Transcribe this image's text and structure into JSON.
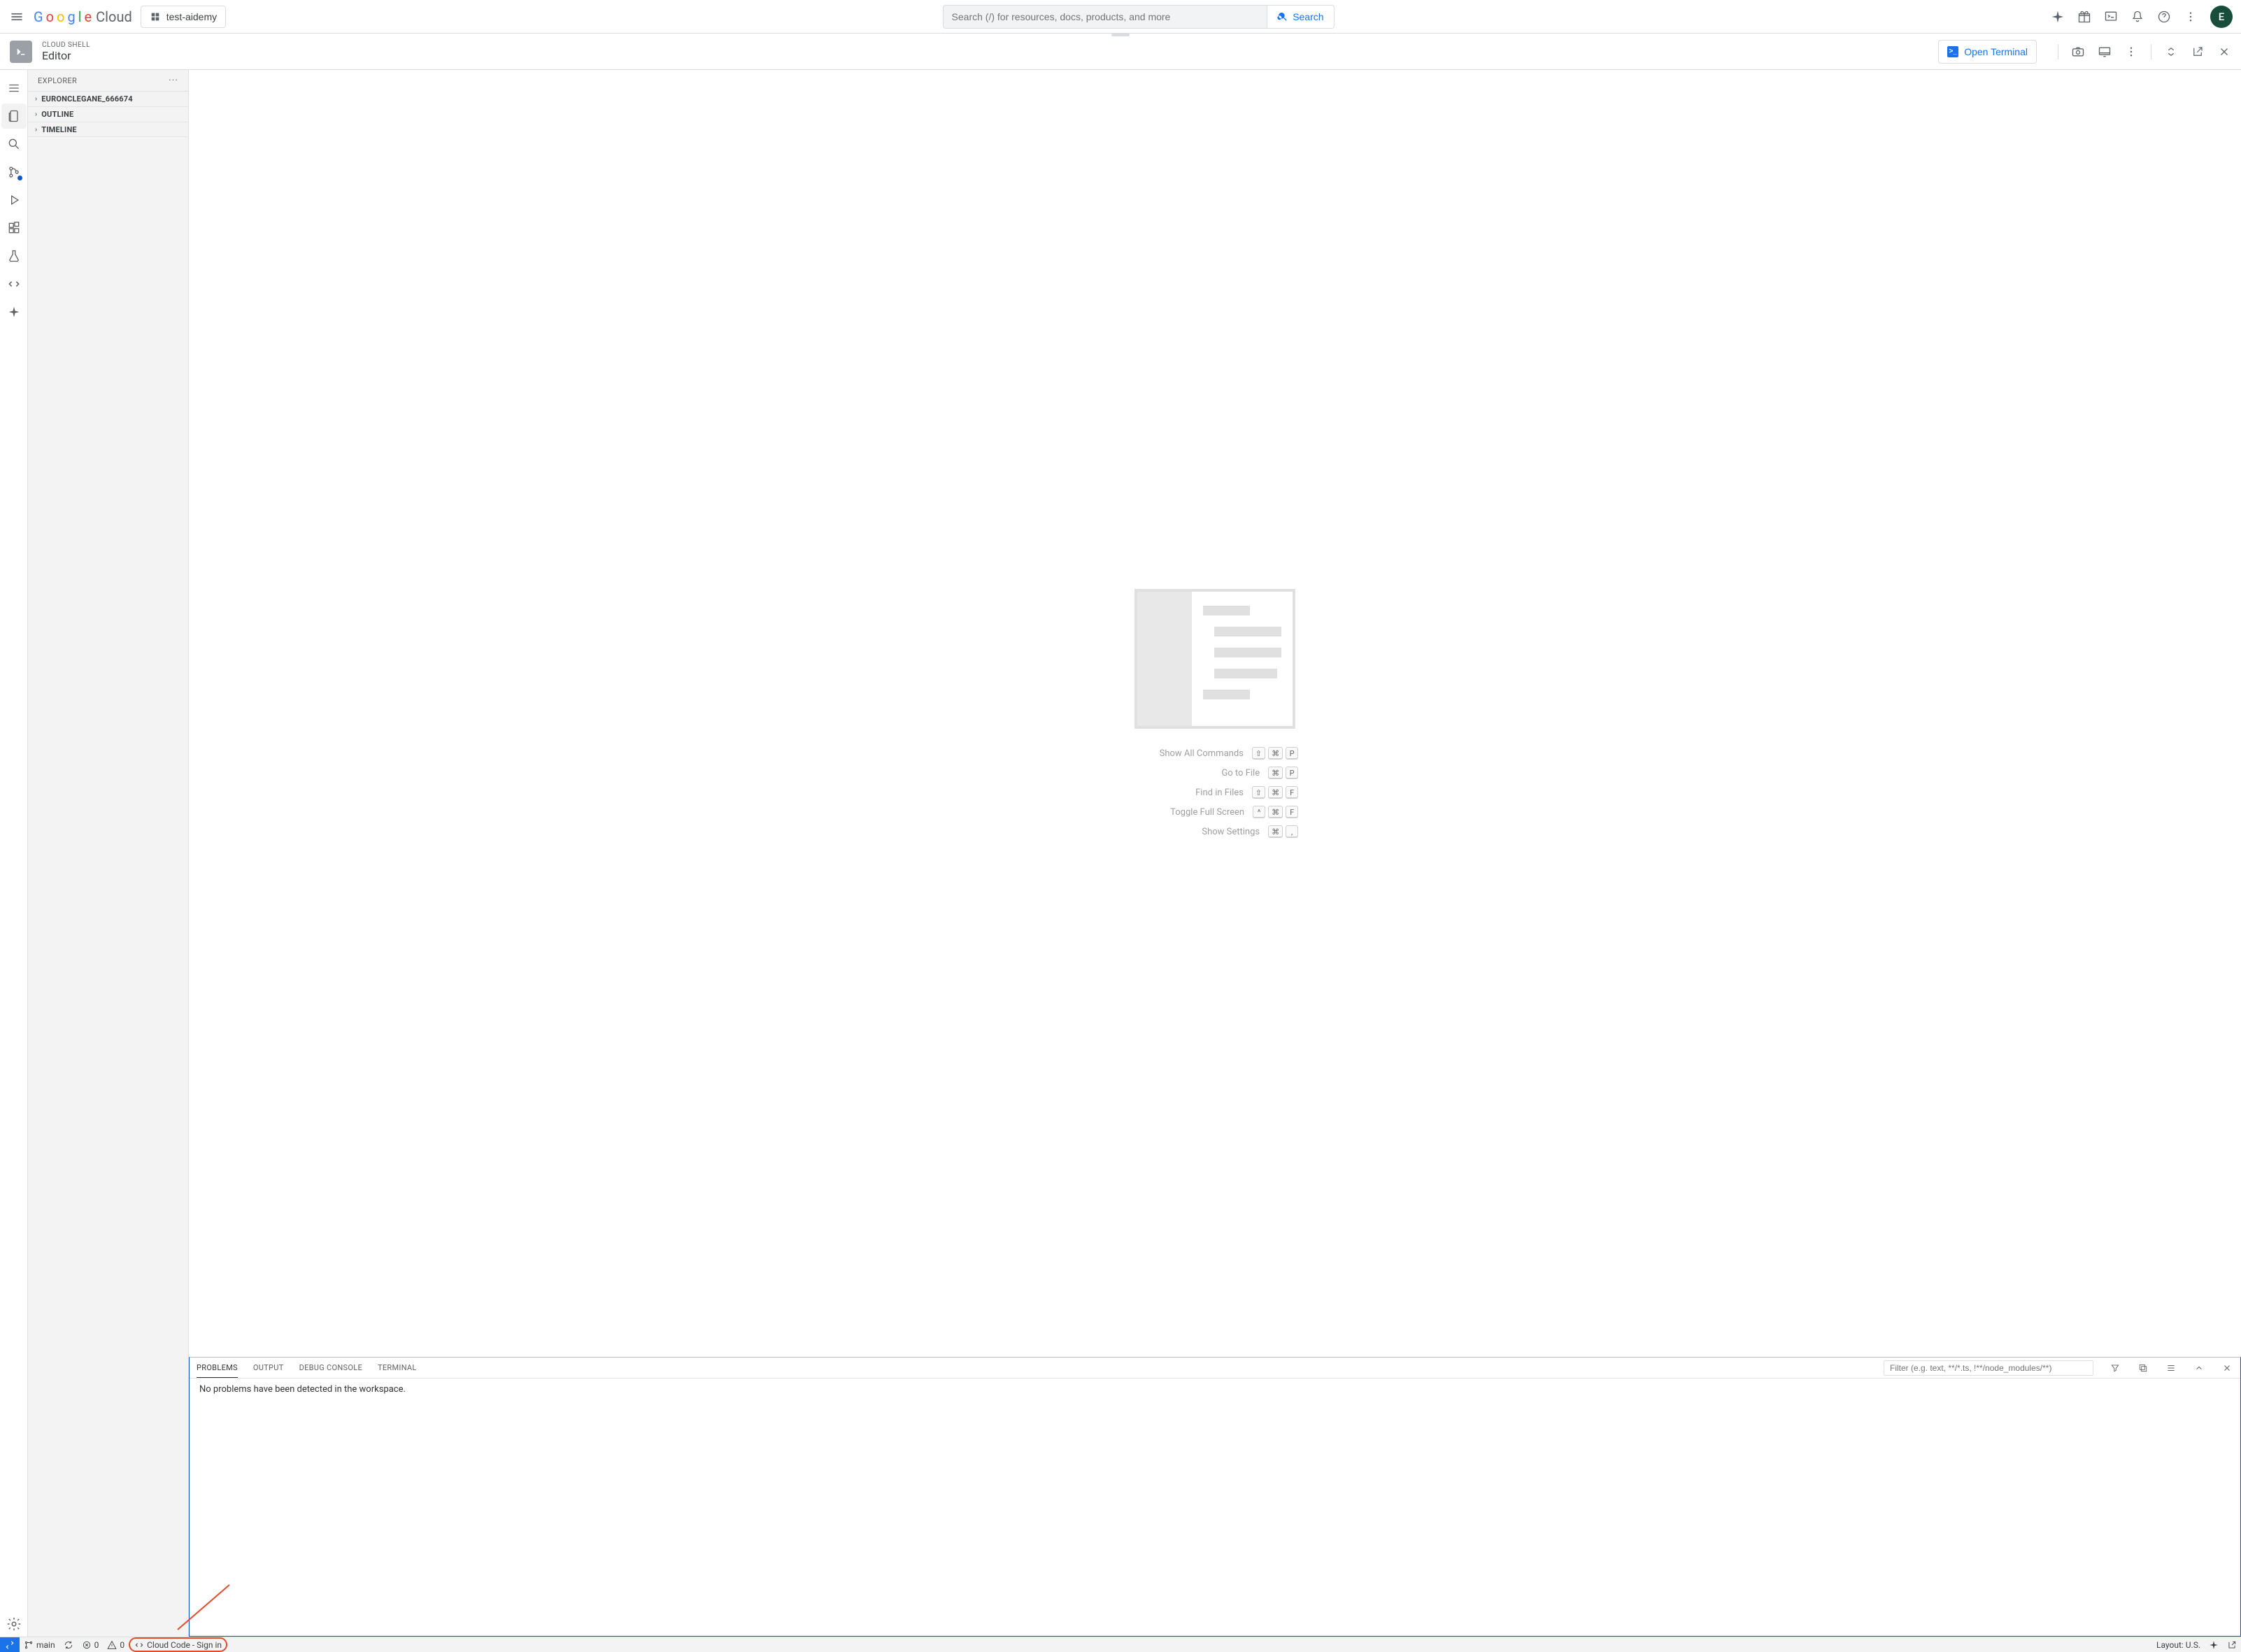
{
  "topnav": {
    "logo_cloud": "Cloud",
    "project": "test-aidemy",
    "search_placeholder": "Search (/) for resources, docs, products, and more",
    "search_button": "Search",
    "avatar_initial": "E"
  },
  "csheader": {
    "small": "CLOUD SHELL",
    "big": "Editor",
    "open_terminal": "Open Terminal"
  },
  "sidebar": {
    "title": "EXPLORER",
    "items": [
      "EURONCLEGANE_666674",
      "OUTLINE",
      "TIMELINE"
    ]
  },
  "welcome": {
    "hints": [
      {
        "label": "Show All Commands",
        "keys": [
          "⇧",
          "⌘",
          "P"
        ]
      },
      {
        "label": "Go to File",
        "keys": [
          "⌘",
          "P"
        ]
      },
      {
        "label": "Find in Files",
        "keys": [
          "⇧",
          "⌘",
          "F"
        ]
      },
      {
        "label": "Toggle Full Screen",
        "keys": [
          "^",
          "⌘",
          "F"
        ]
      },
      {
        "label": "Show Settings",
        "keys": [
          "⌘",
          ","
        ]
      }
    ]
  },
  "panel": {
    "tabs": [
      "PROBLEMS",
      "OUTPUT",
      "DEBUG CONSOLE",
      "TERMINAL"
    ],
    "active_tab": "PROBLEMS",
    "filter_placeholder": "Filter (e.g. text, **/*.ts, !**/node_modules/**)",
    "message": "No problems have been detected in the workspace."
  },
  "statusbar": {
    "branch": "main",
    "errors": "0",
    "warnings": "0",
    "cloud_code": "Cloud Code - Sign in",
    "layout": "Layout: U.S."
  }
}
